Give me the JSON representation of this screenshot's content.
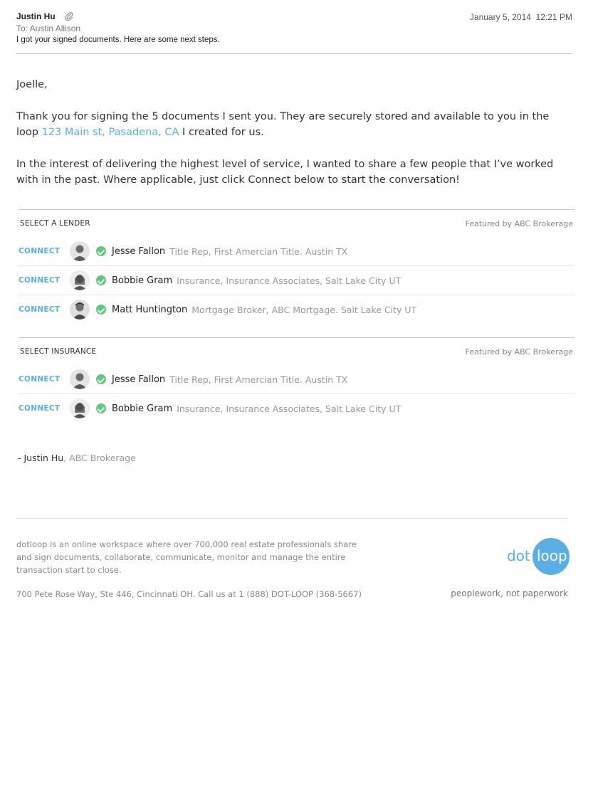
{
  "header": {
    "from": "Justin Hu",
    "date": "January 5, 2014",
    "time": "12:21 PM",
    "to_label": "To:",
    "to": "Austin Allison",
    "subject": "I got your signed documents. Here are some next steps."
  },
  "body": {
    "greeting": "Joelle,",
    "p1_before": "Thank you for signing the 5 documents I sent you. They are securely stored and available to you in the loop ",
    "p1_link": "123 Main st, Pasadena, CA",
    "p1_after": " I created for us.",
    "p2": "In the interest of delivering the highest level of service, I wanted to share a few people that I’ve worked with in the past. Where applicable, just click Connect below to start the conversation!"
  },
  "sections": [
    {
      "title": "SELECT A LENDER",
      "featured": "Featured by ABC Brokerage",
      "rows": [
        {
          "connect": "CONNECT",
          "name": "Jesse Fallon",
          "desc": "Title Rep, First Amercian Title. Austin TX"
        },
        {
          "connect": "CONNECT",
          "name": "Bobbie Gram",
          "desc": "Insurance, Insurance Associates, Salt Lake City UT"
        },
        {
          "connect": "CONNECT",
          "name": "Matt Huntington",
          "desc": "Mortgage Broker,  ABC Mortgage. Salt Lake City UT"
        }
      ]
    },
    {
      "title": "SELECT INSURANCE",
      "featured": "Featured by ABC Brokerage",
      "rows": [
        {
          "connect": "CONNECT",
          "name": "Jesse Fallon",
          "desc": "Title Rep, First Amercian Title. Austin TX"
        },
        {
          "connect": "CONNECT",
          "name": "Bobbie Gram",
          "desc": "Insurance, Insurance Associates, Salt Lake City UT"
        }
      ]
    }
  ],
  "signature": {
    "name": "- Justin Hu",
    "company": ", ABC Brokerage"
  },
  "footer": {
    "about": "dotloop is an online workspace where over 700,000 real estate professionals share and sign documents, collaborate, communicate, monitor and manage the entire transaction start to close.",
    "address": "700 Pete Rose Way, Ste 446, Cincinnati OH. Call us at 1 (888) DOT-LOOP  (368-5667)",
    "logo_dot": "dot",
    "logo_loop": "loop",
    "tagline": "peoplework, not paperwork"
  },
  "colors": {
    "accent": "#5aaee6",
    "check": "#5cc97d"
  }
}
